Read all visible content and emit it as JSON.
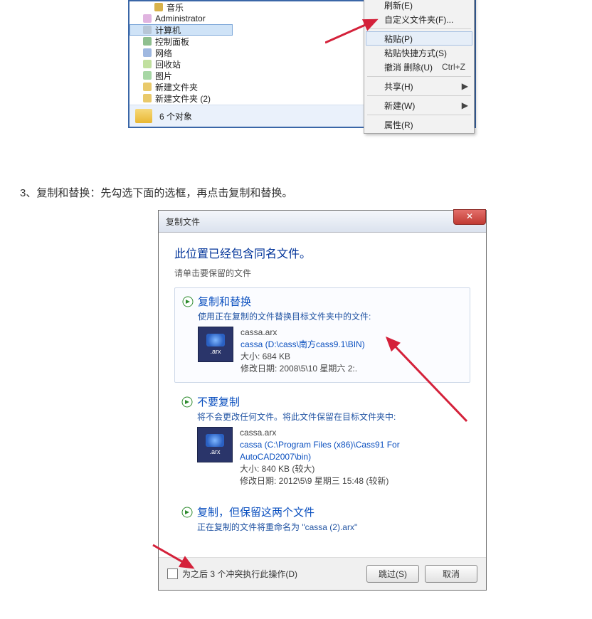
{
  "explorer": {
    "nav": [
      {
        "label": "音乐",
        "iconClass": "ic-music",
        "indent": true
      },
      {
        "label": "Administrator",
        "iconClass": "ic-user",
        "indent": false
      },
      {
        "label": "计算机",
        "iconClass": "ic-pc",
        "indent": false,
        "selected": true
      },
      {
        "label": "控制面板",
        "iconClass": "ic-cp",
        "indent": false
      },
      {
        "label": "网络",
        "iconClass": "ic-net",
        "indent": false
      },
      {
        "label": "回收站",
        "iconClass": "ic-bin",
        "indent": false
      },
      {
        "label": "图片",
        "iconClass": "ic-pic",
        "indent": false
      },
      {
        "label": "新建文件夹",
        "iconClass": "ic-fold",
        "indent": false
      },
      {
        "label": "新建文件夹 (2)",
        "iconClass": "ic-fold",
        "indent": false
      }
    ],
    "context_menu": [
      {
        "label": "刷新(E)"
      },
      {
        "label": "自定义文件夹(F)..."
      },
      {
        "divider": true
      },
      {
        "label": "粘贴(P)",
        "highlight": true
      },
      {
        "label": "粘贴快捷方式(S)"
      },
      {
        "label": "撤消 删除(U)",
        "shortcut": "Ctrl+Z"
      },
      {
        "divider": true
      },
      {
        "label": "共享(H)",
        "submenu": true
      },
      {
        "divider": true
      },
      {
        "label": "新建(W)",
        "submenu": true
      },
      {
        "divider": true
      },
      {
        "label": "属性(R)"
      }
    ],
    "status": "6 个对象"
  },
  "step_text": "3、复制和替换：先勾选下面的选框，再点击复制和替换。",
  "dialog": {
    "title": "复制文件",
    "close_label": "✕",
    "heading": "此位置已经包含同名文件。",
    "subheading": "请单击要保留的文件",
    "opt1": {
      "title": "复制和替换",
      "desc": "使用正在复制的文件替换目标文件夹中的文件:",
      "fname": "cassa.arx",
      "path": "cassa (D:\\cass\\南方cass9.1\\BIN)",
      "size": "大小: 684 KB",
      "date": "修改日期: 2008\\5\\10 星期六 2:."
    },
    "opt2": {
      "title": "不要复制",
      "desc": "将不会更改任何文件。将此文件保留在目标文件夹中:",
      "fname": "cassa.arx",
      "path": "cassa (C:\\Program Files (x86)\\Cass91 For AutoCAD2007\\bin)",
      "size": "大小: 840 KB (较大)",
      "date": "修改日期: 2012\\5\\9 星期三 15:48 (较新)"
    },
    "opt3": {
      "title": "复制，但保留这两个文件",
      "desc": "正在复制的文件将重命名为 \"cassa (2).arx\""
    },
    "footer": {
      "checkbox_label": "为之后 3 个冲突执行此操作(D)",
      "skip": "跳过(S)",
      "cancel": "取消"
    }
  },
  "icon_text": ".arx"
}
